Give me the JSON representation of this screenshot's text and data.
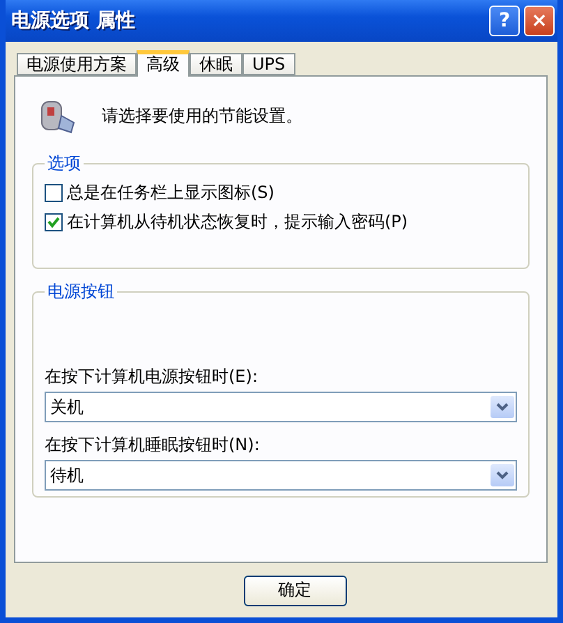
{
  "window": {
    "title": "电源选项 属性",
    "buttons": [
      "?",
      "×"
    ]
  },
  "tabs": [
    {
      "label": "电源使用方案",
      "selected": false
    },
    {
      "label": "高级",
      "selected": true
    },
    {
      "label": "休眠",
      "selected": false
    },
    {
      "label": "UPS",
      "selected": false
    }
  ],
  "intro": "请选择要使用的节能设置。",
  "options": {
    "title": "选项",
    "items": [
      {
        "label": "总是在任务栏上显示图标(S)",
        "checked": false
      },
      {
        "label": "在计算机从待机状态恢复时，提示输入密码(P)",
        "checked": true
      }
    ]
  },
  "power_buttons": {
    "title": "电源按钮",
    "fields": [
      {
        "label": "在按下计算机电源按钮时(E):",
        "value": "关机"
      },
      {
        "label": "在按下计算机睡眠按钮时(N):",
        "value": "待机"
      }
    ]
  },
  "buttons": [
    "确定"
  ]
}
